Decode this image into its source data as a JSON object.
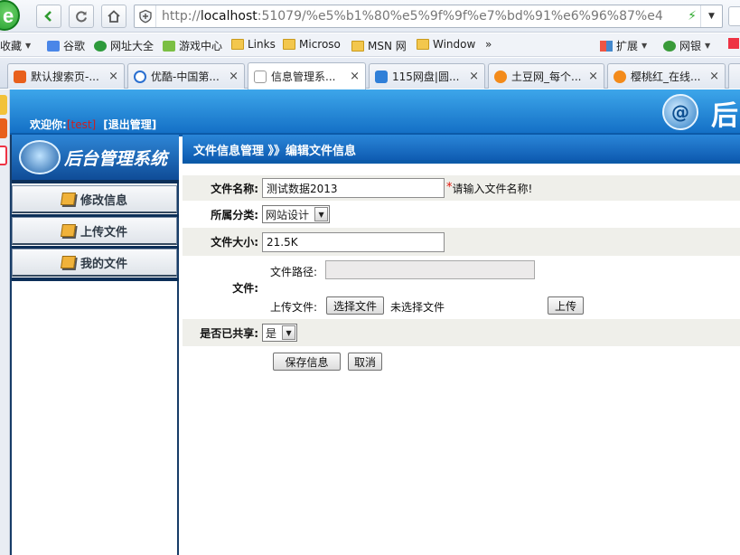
{
  "browser": {
    "address": "http://localhost:51079/%e5%b1%80%e5%9f%9f%e7%bd%91%e6%96%87%e4",
    "address_host": "localhost",
    "address_prefix": "http://",
    "address_rest": ":51079/%e5%b1%80%e5%9f%9f%e7%bd%91%e6%96%87%e4",
    "bookmarks": [
      {
        "label": "收藏"
      },
      {
        "label": "谷歌"
      },
      {
        "label": "网址大全"
      },
      {
        "label": "游戏中心"
      },
      {
        "label": "Links"
      },
      {
        "label": "Microso"
      },
      {
        "label": "MSN 网"
      },
      {
        "label": "Window"
      }
    ],
    "bookmarks_more": "»",
    "extensions_label": "扩展",
    "netbank_label": "网银",
    "tabs": [
      {
        "label": "默认搜索页-...",
        "close": "×"
      },
      {
        "label": "优酷-中国第...",
        "close": "×"
      },
      {
        "label": "信息管理系...",
        "close": "×"
      },
      {
        "label": "115网盘|圆...",
        "close": "×"
      },
      {
        "label": "土豆网_每个...",
        "close": "×"
      },
      {
        "label": "樱桃红_在线...",
        "close": "×"
      }
    ]
  },
  "header": {
    "welcome_label": "欢迎你:",
    "username": "[test]",
    "logout": "[退出管理]",
    "brand_text": "后台"
  },
  "sidebar": {
    "title": "后台管理系统",
    "items": [
      {
        "label": "修改信息"
      },
      {
        "label": "上传文件"
      },
      {
        "label": "我的文件"
      }
    ]
  },
  "main": {
    "breadcrumb": "文件信息管理 》》编辑文件信息",
    "form": {
      "file_name_label": "文件名称:",
      "file_name_value": "测试数据2013",
      "required_star": "*",
      "file_name_hint": "请输入文件名称!",
      "category_label": "所属分类:",
      "category_value": "网站设计",
      "size_label": "文件大小:",
      "size_value": "21.5K",
      "file_label": "文件:",
      "path_label": "文件路径:",
      "path_value": "",
      "upload_label": "上传文件:",
      "choose_file_button": "选择文件",
      "no_file_text": "未选择文件",
      "upload_button": "上传",
      "shared_label": "是否已共享:",
      "shared_value": "是",
      "save_button": "保存信息",
      "cancel_button": "取消"
    }
  }
}
